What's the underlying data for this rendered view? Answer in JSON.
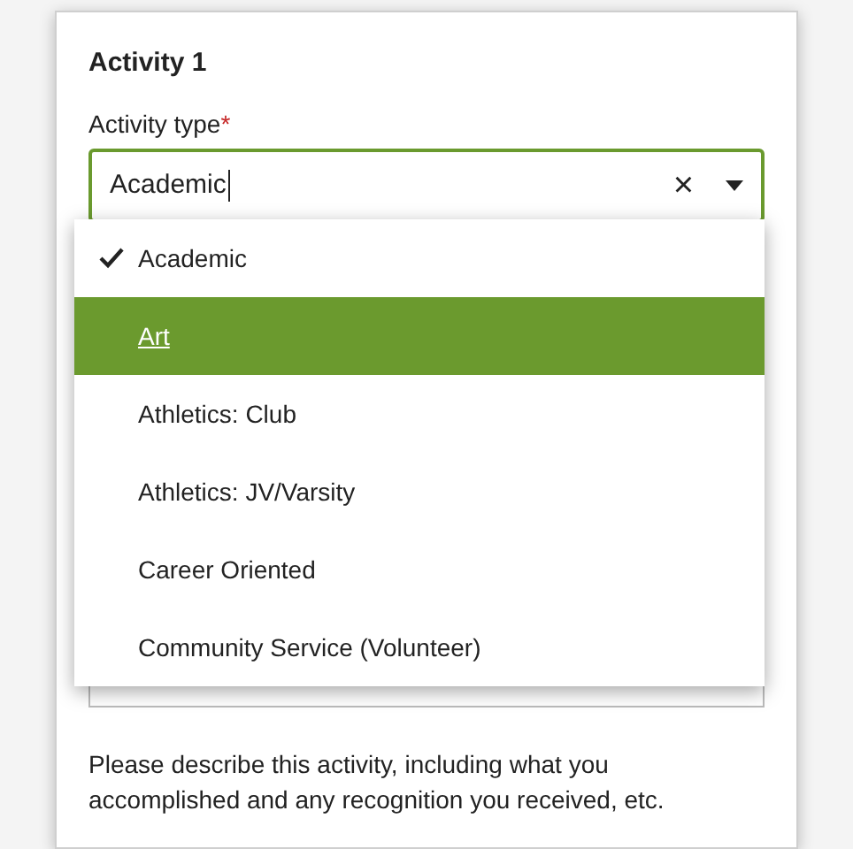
{
  "section": {
    "title": "Activity 1"
  },
  "field": {
    "label": "Activity type",
    "required_mark": "*",
    "value": "Academic",
    "focused": true,
    "clear_button": "×"
  },
  "options": [
    {
      "label": "Academic",
      "checked": true,
      "selected": false
    },
    {
      "label": "Art",
      "checked": false,
      "selected": true
    },
    {
      "label": "Athletics: Club",
      "checked": false,
      "selected": false
    },
    {
      "label": "Athletics: JV/Varsity",
      "checked": false,
      "selected": false
    },
    {
      "label": "Career Oriented",
      "checked": false,
      "selected": false
    },
    {
      "label": "Community Service (Volunteer)",
      "checked": false,
      "selected": false
    }
  ],
  "description_prompt": "Please describe this activity, including what you accomplished and any recognition you received, etc."
}
